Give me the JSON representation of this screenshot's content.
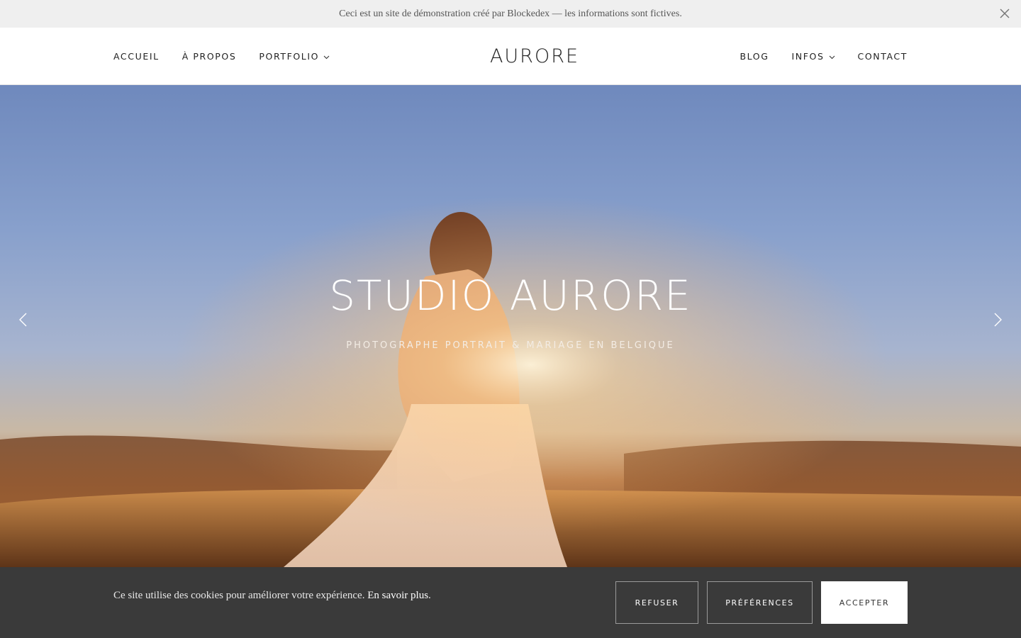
{
  "demo_banner": {
    "text": "Ceci est un site de démonstration créé par Blockedex — les informations sont fictives.",
    "close_icon": "close-icon"
  },
  "header": {
    "logo": "AURORE",
    "nav_left": [
      {
        "label": "ACCUEIL"
      },
      {
        "label": "À PROPOS"
      },
      {
        "label": "PORTFOLIO",
        "has_dropdown": true
      }
    ],
    "nav_right": [
      {
        "label": "BLOG"
      },
      {
        "label": "INFOS",
        "has_dropdown": true
      },
      {
        "label": "CONTACT"
      }
    ]
  },
  "hero": {
    "title": "STUDIO AURORE",
    "subtitle": "PHOTOGRAPHE PORTRAIT & MARIAGE EN BELGIQUE",
    "prev_icon": "chevron-left-icon",
    "next_icon": "chevron-right-icon"
  },
  "cookie_bar": {
    "text": "Ce site utilise des cookies pour améliorer votre expérience.",
    "link": "En savoir plus",
    "link_suffix": ".",
    "refuse": "REFUSER",
    "preferences": "PRÉFÉRENCES",
    "accept": "ACCEPTER"
  },
  "colors": {
    "banner_bg": "#efefef",
    "cookie_bg": "#3a3a3a",
    "sky_top": "#6f89bd",
    "ground": "#8c552e"
  }
}
